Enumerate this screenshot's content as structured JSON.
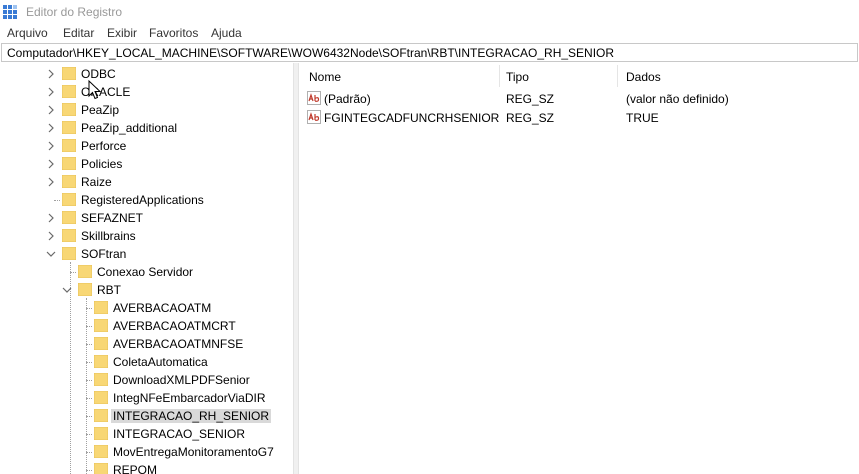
{
  "window": {
    "title": "Editor do Registro"
  },
  "menu": [
    "Arquivo",
    "Editar",
    "Exibir",
    "Favoritos",
    "Ajuda"
  ],
  "address": {
    "path": "Computador\\HKEY_LOCAL_MACHINE\\SOFTWARE\\WOW6432Node\\SOFtran\\RBT\\INTEGRACAO_RH_SENIOR"
  },
  "tree": {
    "items": [
      {
        "label": "ODBC",
        "level": 0,
        "expander": "collapsed"
      },
      {
        "label": "ORACLE",
        "level": 0,
        "expander": "collapsed"
      },
      {
        "label": "PeaZip",
        "level": 0,
        "expander": "collapsed"
      },
      {
        "label": "PeaZip_additional",
        "level": 0,
        "expander": "collapsed"
      },
      {
        "label": "Perforce",
        "level": 0,
        "expander": "collapsed"
      },
      {
        "label": "Policies",
        "level": 0,
        "expander": "collapsed"
      },
      {
        "label": "Raize",
        "level": 0,
        "expander": "collapsed"
      },
      {
        "label": "RegisteredApplications",
        "level": 0,
        "expander": "none"
      },
      {
        "label": "SEFAZNET",
        "level": 0,
        "expander": "collapsed"
      },
      {
        "label": "Skillbrains",
        "level": 0,
        "expander": "collapsed"
      },
      {
        "label": "SOFtran",
        "level": 0,
        "expander": "expanded"
      },
      {
        "label": "Conexao Servidor",
        "level": 1,
        "expander": "none"
      },
      {
        "label": "RBT",
        "level": 1,
        "expander": "expanded"
      },
      {
        "label": "AVERBACAOATM",
        "level": 2,
        "expander": "none"
      },
      {
        "label": "AVERBACAOATMCRT",
        "level": 2,
        "expander": "none"
      },
      {
        "label": "AVERBACAOATMNFSE",
        "level": 2,
        "expander": "none"
      },
      {
        "label": "ColetaAutomatica",
        "level": 2,
        "expander": "none"
      },
      {
        "label": "DownloadXMLPDFSenior",
        "level": 2,
        "expander": "none"
      },
      {
        "label": "IntegNFeEmbarcadorViaDIR",
        "level": 2,
        "expander": "none"
      },
      {
        "label": "INTEGRACAO_RH_SENIOR",
        "level": 2,
        "expander": "none",
        "selected": true
      },
      {
        "label": "INTEGRACAO_SENIOR",
        "level": 2,
        "expander": "none"
      },
      {
        "label": "MovEntregaMonitoramentoG7",
        "level": 2,
        "expander": "none"
      },
      {
        "label": "REPOM",
        "level": 2,
        "expander": "none"
      }
    ]
  },
  "values": {
    "headers": {
      "name": "Nome",
      "type": "Tipo",
      "data": "Dados"
    },
    "rows": [
      {
        "name": "(Padrão)",
        "type": "REG_SZ",
        "data": "(valor não definido)",
        "icon": "string-value-icon"
      },
      {
        "name": "FGINTEGCADFUNCRHSENIOR",
        "type": "REG_SZ",
        "data": "TRUE",
        "icon": "string-value-icon"
      }
    ]
  },
  "colors": {
    "folder": "#f8d775",
    "folder_dark": "#e0b64a",
    "selection": "#d9d9d9",
    "ab_icon": "#c0392b"
  }
}
